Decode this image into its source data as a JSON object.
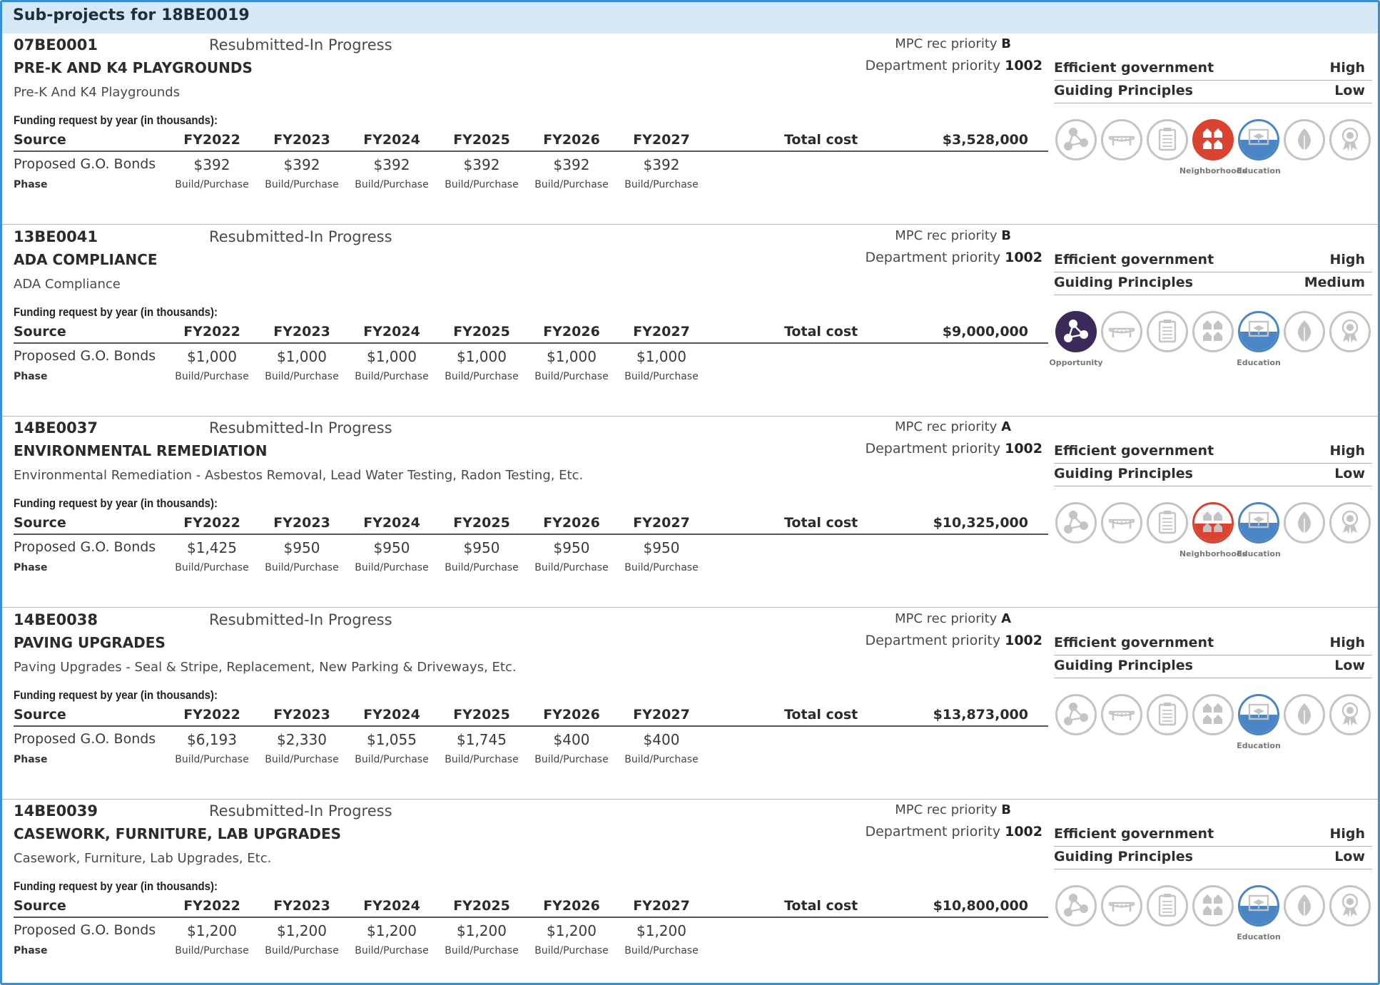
{
  "header": {
    "title": "Sub-projects for 18BE0019"
  },
  "labels": {
    "mpc": "MPC rec priority",
    "dept": "Department priority",
    "funding": "Funding request by year (in thousands):",
    "source": "Source",
    "total_cost": "Total cost",
    "phase": "Phase",
    "efficient": "Efficient government",
    "guiding": "Guiding Principles"
  },
  "years": [
    "FY2022",
    "FY2023",
    "FY2024",
    "FY2025",
    "FY2026",
    "FY2027"
  ],
  "icon_names": [
    "opportunity-icon",
    "bridge-icon",
    "clipboard-icon",
    "neighborhoods-icon",
    "education-icon",
    "environment-icon",
    "award-icon"
  ],
  "colors": {
    "accent_red": "#d9432f",
    "accent_purple": "#3b2a5a",
    "accent_blue": "#4a86c5",
    "inactive": "#c4c4c4",
    "header_bg": "#d5e8f5"
  },
  "projects": [
    {
      "id": "07BE0001",
      "status": "Resubmitted-In Progress",
      "name": "PRE-K AND K4 PLAYGROUNDS",
      "description": "Pre-K And K4 Playgrounds",
      "mpc_priority": "B",
      "dept_priority": "1002",
      "total_cost": "$3,528,000",
      "efficient_value": "High",
      "guiding_value": "Low",
      "source": "Proposed G.O. Bonds",
      "values": [
        "$392",
        "$392",
        "$392",
        "$392",
        "$392",
        "$392"
      ],
      "phases": [
        "Build/Purchase",
        "Build/Purchase",
        "Build/Purchase",
        "Build/Purchase",
        "Build/Purchase",
        "Build/Purchase"
      ],
      "icon_states": [
        "off",
        "off",
        "off",
        "red",
        "edu",
        "off",
        "off"
      ],
      "icon_labels": [
        "",
        "",
        "",
        "Neighborhoods",
        "Education",
        "",
        ""
      ]
    },
    {
      "id": "13BE0041",
      "status": "Resubmitted-In Progress",
      "name": "ADA COMPLIANCE",
      "description": "ADA Compliance",
      "mpc_priority": "B",
      "dept_priority": "1002",
      "total_cost": "$9,000,000",
      "efficient_value": "High",
      "guiding_value": "Medium",
      "source": "Proposed G.O. Bonds",
      "values": [
        "$1,000",
        "$1,000",
        "$1,000",
        "$1,000",
        "$1,000",
        "$1,000"
      ],
      "phases": [
        "Build/Purchase",
        "Build/Purchase",
        "Build/Purchase",
        "Build/Purchase",
        "Build/Purchase",
        "Build/Purchase"
      ],
      "icon_states": [
        "purple",
        "off",
        "off",
        "off",
        "edu",
        "off",
        "off"
      ],
      "icon_labels": [
        "Opportunity",
        "",
        "",
        "",
        "Education",
        "",
        ""
      ]
    },
    {
      "id": "14BE0037",
      "status": "Resubmitted-In Progress",
      "name": "ENVIRONMENTAL REMEDIATION",
      "description": "Environmental Remediation - Asbestos Removal, Lead Water Testing, Radon Testing, Etc.",
      "mpc_priority": "A",
      "dept_priority": "1002",
      "total_cost": "$10,325,000",
      "efficient_value": "High",
      "guiding_value": "Low",
      "source": "Proposed G.O. Bonds",
      "values": [
        "$1,425",
        "$950",
        "$950",
        "$950",
        "$950",
        "$950"
      ],
      "phases": [
        "Build/Purchase",
        "Build/Purchase",
        "Build/Purchase",
        "Build/Purchase",
        "Build/Purchase",
        "Build/Purchase"
      ],
      "icon_states": [
        "off",
        "off",
        "off",
        "halfred",
        "edu",
        "off",
        "off"
      ],
      "icon_labels": [
        "",
        "",
        "",
        "Neighborhoods",
        "Education",
        "",
        ""
      ]
    },
    {
      "id": "14BE0038",
      "status": "Resubmitted-In Progress",
      "name": "PAVING UPGRADES",
      "description": "Paving Upgrades - Seal & Stripe, Replacement, New Parking & Driveways, Etc.",
      "mpc_priority": "A",
      "dept_priority": "1002",
      "total_cost": "$13,873,000",
      "efficient_value": "High",
      "guiding_value": "Low",
      "source": "Proposed G.O. Bonds",
      "values": [
        "$6,193",
        "$2,330",
        "$1,055",
        "$1,745",
        "$400",
        "$400"
      ],
      "phases": [
        "Build/Purchase",
        "Build/Purchase",
        "Build/Purchase",
        "Build/Purchase",
        "Build/Purchase",
        "Build/Purchase"
      ],
      "icon_states": [
        "off",
        "off",
        "off",
        "off",
        "edu",
        "off",
        "off"
      ],
      "icon_labels": [
        "",
        "",
        "",
        "",
        "Education",
        "",
        ""
      ]
    },
    {
      "id": "14BE0039",
      "status": "Resubmitted-In Progress",
      "name": "CASEWORK, FURNITURE, LAB UPGRADES",
      "description": "Casework, Furniture, Lab Upgrades, Etc.",
      "mpc_priority": "B",
      "dept_priority": "1002",
      "total_cost": "$10,800,000",
      "efficient_value": "High",
      "guiding_value": "Low",
      "source": "Proposed G.O. Bonds",
      "values": [
        "$1,200",
        "$1,200",
        "$1,200",
        "$1,200",
        "$1,200",
        "$1,200"
      ],
      "phases": [
        "Build/Purchase",
        "Build/Purchase",
        "Build/Purchase",
        "Build/Purchase",
        "Build/Purchase",
        "Build/Purchase"
      ],
      "icon_states": [
        "off",
        "off",
        "off",
        "off",
        "edu",
        "off",
        "off"
      ],
      "icon_labels": [
        "",
        "",
        "",
        "",
        "Education",
        "",
        ""
      ]
    }
  ]
}
